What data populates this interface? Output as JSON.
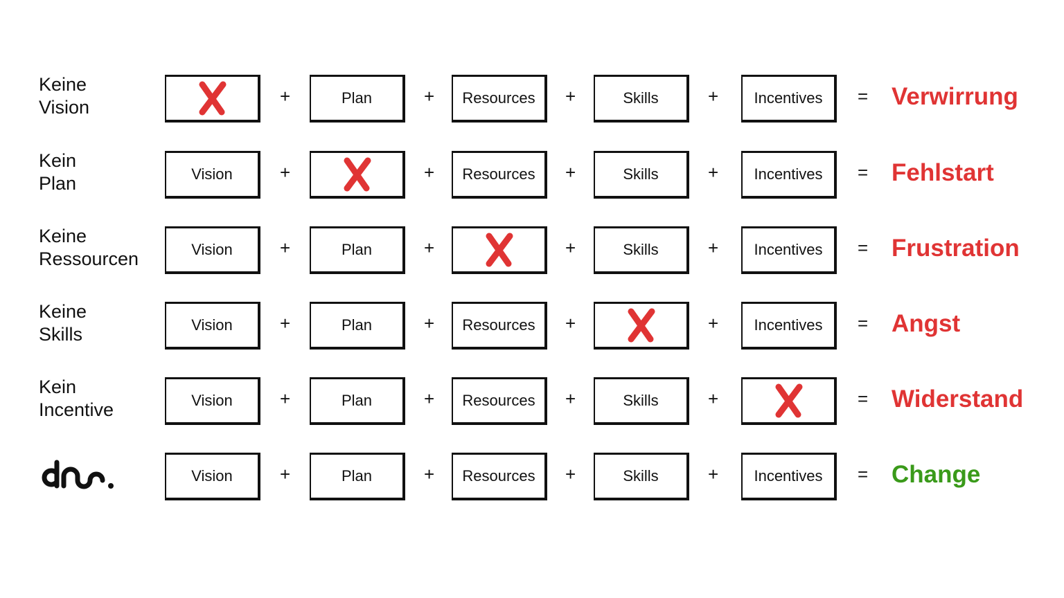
{
  "colors": {
    "negative": "#e03434",
    "positive": "#3a9a1a",
    "cross": "#e03434"
  },
  "operators": {
    "plus": "+",
    "equals": "="
  },
  "rows": [
    {
      "label": "Keine\nVision",
      "items": [
        "",
        "Plan",
        "Resources",
        "Skills",
        "Incentives"
      ],
      "missing": 0,
      "result": "Verwirrung",
      "positive": false
    },
    {
      "label": "Kein\nPlan",
      "items": [
        "Vision",
        "",
        "Resources",
        "Skills",
        "Incentives"
      ],
      "missing": 1,
      "result": "Fehlstart",
      "positive": false
    },
    {
      "label": "Keine\nRessourcen",
      "items": [
        "Vision",
        "Plan",
        "",
        "Skills",
        "Incentives"
      ],
      "missing": 2,
      "result": "Frustration",
      "positive": false
    },
    {
      "label": "Keine\nSkills",
      "items": [
        "Vision",
        "Plan",
        "Resources",
        "",
        "Incentives"
      ],
      "missing": 3,
      "result": "Angst",
      "positive": false
    },
    {
      "label": "Kein\nIncentive",
      "items": [
        "Vision",
        "Plan",
        "Resources",
        "Skills",
        ""
      ],
      "missing": 4,
      "result": "Widerstand",
      "positive": false
    },
    {
      "label": "",
      "logo": "dno.",
      "items": [
        "Vision",
        "Plan",
        "Resources",
        "Skills",
        "Incentives"
      ],
      "missing": -1,
      "result": "Change",
      "positive": true
    }
  ]
}
